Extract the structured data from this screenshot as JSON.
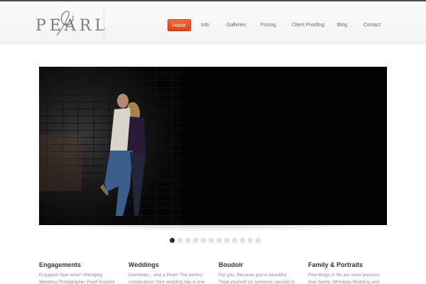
{
  "brand": {
    "logo_text": "PEARL"
  },
  "nav": {
    "items": [
      {
        "label": "Home",
        "active": true
      },
      {
        "label": "Info",
        "active": false
      },
      {
        "label": "Galleries",
        "active": false
      },
      {
        "label": "Pricing",
        "active": false
      },
      {
        "label": "Client Proofing",
        "active": false
      },
      {
        "label": "Blog",
        "active": false
      },
      {
        "label": "Contact",
        "active": false
      }
    ]
  },
  "slider": {
    "slide_count": 12,
    "active_slide": 1
  },
  "features": [
    {
      "title": "Engagements",
      "text": "Engaged! Now what? Winnipeg Wedding Photographer Pearl Angelini"
    },
    {
      "title": "Weddings",
      "text": "Diamonds... and a Pearl! The perfect combination! Your wedding day is one"
    },
    {
      "title": "Boudoir",
      "text": "For you. Because you're beautiful. Treat yourself (or someone special) to a"
    },
    {
      "title": "Family & Portraits",
      "text": "Few things in life are more precious than family. Winnipeg Wedding and"
    }
  ],
  "colors": {
    "accent": "#e0522a",
    "header_bg": "#f6f6f6",
    "slider_bg": "#050505",
    "text_muted": "#8a8a8a"
  }
}
